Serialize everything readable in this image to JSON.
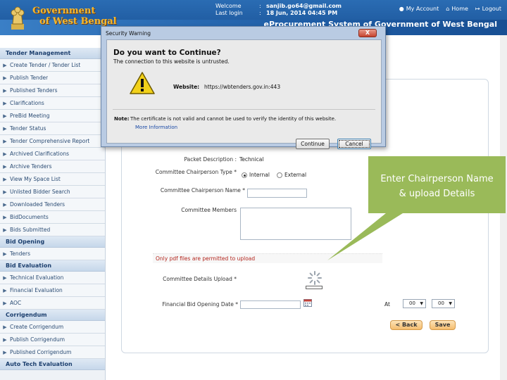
{
  "header": {
    "gov_line1": "Government",
    "gov_line2": "of West Bengal",
    "welcome_key": "Welcome",
    "welcome_value": "sanjib.go64@gmail.com",
    "last_login_key": "Last login",
    "last_login_value": "18 Jun, 2014 04:45 PM",
    "colon": ":",
    "my_account": "My Account",
    "home": "Home",
    "logout": "Logout",
    "system_title": "eProcurement System of Government of West Bengal"
  },
  "sidebar": {
    "sections": [
      {
        "title": "Tender Management",
        "items": [
          "Create Tender / Tender List",
          "Publish Tender",
          "Published Tenders",
          "Clarifications",
          "PreBid Meeting",
          "Tender Status",
          "Tender Comprehensive Report",
          "Archived Clarifications",
          "Archive Tenders",
          "View My Space List",
          "Unlisted Bidder Search",
          "Downloaded Tenders",
          "BidDocuments",
          "Bids Submitted"
        ]
      },
      {
        "title": "Bid Opening",
        "items": [
          "Tenders"
        ]
      },
      {
        "title": "Bid Evaluation",
        "items": [
          "Technical Evaluation",
          "Financial Evaluation",
          "AOC"
        ]
      },
      {
        "title": "Corrigendum",
        "items": [
          "Create Corrigendum",
          "Publish Corrigendum",
          "Published Corrigendum"
        ]
      },
      {
        "title": "Auto Tech Evaluation",
        "items": []
      }
    ]
  },
  "form": {
    "packet_label": "Packet Description :",
    "packet_value": "Technical",
    "chair_type_label": "Committee Chairperson Type *",
    "radio_internal": "Internal",
    "radio_external": "External",
    "chair_name_label": "Committee Chairperson Name *",
    "members_label": "Committee Members",
    "pdf_note": "Only pdf files are permitted to upload",
    "details_upload_label": "Committee Details Upload *",
    "fin_bid_date_label": "Financial Bid Opening Date *",
    "at_label": "At",
    "hour_value": "00",
    "minute_value": "00",
    "back_label": "< Back",
    "save_label": "Save"
  },
  "callout": {
    "line1": "Enter Chairperson Name",
    "line2": "& upload Details"
  },
  "dialog": {
    "title": "Security Warning",
    "close_label": "X",
    "question": "Do you want to Continue?",
    "subtitle": "The connection to this website is untrusted.",
    "website_key": "Website:",
    "website_value": "https://wbtenders.gov.in:443",
    "note_key": "Note:",
    "note_value": "The certificate is not valid and cannot be used to verify the identity of this website.",
    "more_info": "More Information",
    "continue_label": "Continue",
    "cancel_label": "Cancel"
  },
  "colors": {
    "header_blue": "#1b5499",
    "gov_gold": "#f5b82e",
    "callout_green": "#9aba59",
    "note_red": "#b3261e",
    "button_orange": "#f5bd6e"
  }
}
